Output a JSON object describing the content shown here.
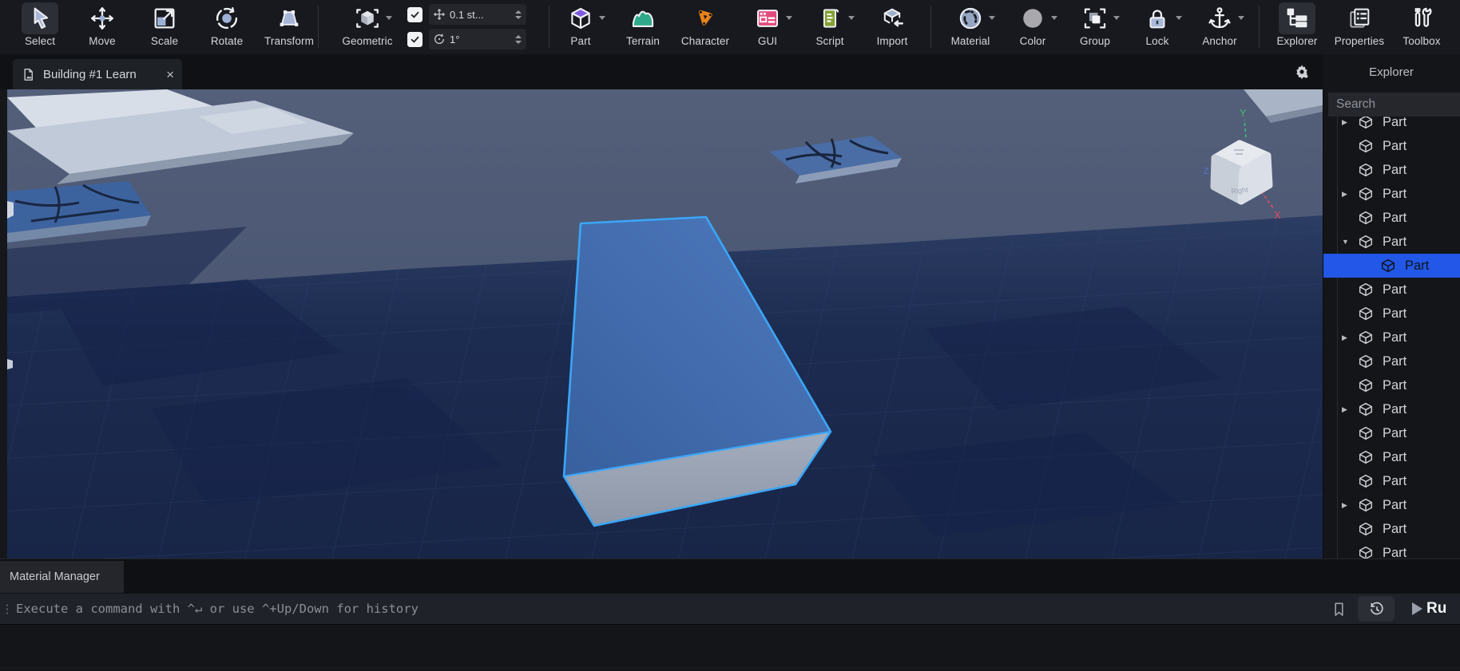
{
  "toolbar": {
    "groups": [
      [
        {
          "label": "Select",
          "icon": "cursor",
          "active": true
        },
        {
          "label": "Move",
          "icon": "move"
        },
        {
          "label": "Scale",
          "icon": "scale"
        },
        {
          "label": "Rotate",
          "icon": "rotate"
        },
        {
          "label": "Transform",
          "icon": "transform"
        }
      ],
      [
        {
          "label": "Geometric",
          "icon": "geometric",
          "caret": true
        }
      ],
      [
        {
          "label": "Part",
          "icon": "part",
          "caret": true
        },
        {
          "label": "Terrain",
          "icon": "terrain"
        },
        {
          "label": "Character",
          "icon": "character"
        },
        {
          "label": "GUI",
          "icon": "gui",
          "caret": true
        },
        {
          "label": "Script",
          "icon": "script",
          "caret": true
        },
        {
          "label": "Import",
          "icon": "import"
        }
      ],
      [
        {
          "label": "Material",
          "icon": "material",
          "caret": true
        },
        {
          "label": "Color",
          "icon": "color",
          "caret": true
        },
        {
          "label": "Group",
          "icon": "group",
          "caret": true
        },
        {
          "label": "Lock",
          "icon": "lock",
          "caret": true
        },
        {
          "label": "Anchor",
          "icon": "anchor",
          "caret": true
        }
      ],
      [
        {
          "label": "Explorer",
          "icon": "explorer",
          "active": true
        },
        {
          "label": "Properties",
          "icon": "properties"
        },
        {
          "label": "Toolbox",
          "icon": "toolbox"
        }
      ]
    ],
    "snap": {
      "move": {
        "checked": true,
        "value": "0.1 st...",
        "icon": "move-snap"
      },
      "rotate": {
        "checked": true,
        "value": "1°",
        "icon": "rotate-snap"
      }
    }
  },
  "tab": {
    "title": "Building #1 Learn",
    "close": "×"
  },
  "explorer": {
    "title": "Explorer",
    "search_placeholder": "Search",
    "items": [
      {
        "label": "Part",
        "arrow": "right"
      },
      {
        "label": "Part"
      },
      {
        "label": "Part"
      },
      {
        "label": "Part",
        "arrow": "right"
      },
      {
        "label": "Part"
      },
      {
        "label": "Part",
        "arrow": "down"
      },
      {
        "label": "Part",
        "selected": true,
        "indent": 1
      },
      {
        "label": "Part"
      },
      {
        "label": "Part"
      },
      {
        "label": "Part",
        "arrow": "right"
      },
      {
        "label": "Part"
      },
      {
        "label": "Part"
      },
      {
        "label": "Part",
        "arrow": "right"
      },
      {
        "label": "Part"
      },
      {
        "label": "Part"
      },
      {
        "label": "Part"
      },
      {
        "label": "Part",
        "arrow": "right"
      },
      {
        "label": "Part"
      },
      {
        "label": "Part"
      }
    ]
  },
  "viewport": {
    "viewcube": {
      "y_label": "Y",
      "x_label": "X",
      "z_label": "Z",
      "face_label": "Right"
    }
  },
  "bottom": {
    "material_manager": "Material Manager",
    "command_placeholder": "Execute a command with ^↵ or use ^+Up/Down for history",
    "run_label": "Ru"
  },
  "colors": {
    "selection_blue": "#2257e7",
    "selection_outline": "#3ba6f7",
    "part_fill": "#4070b4",
    "checkbox_bg": "#f2f3f5"
  }
}
